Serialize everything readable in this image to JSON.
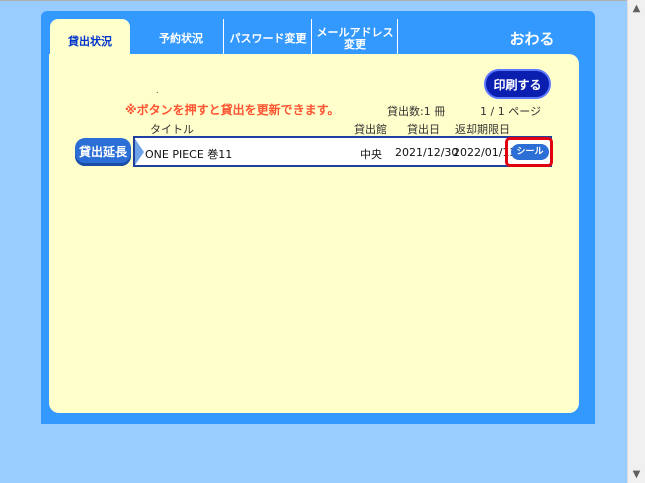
{
  "tabs": [
    {
      "label": "貸出状況"
    },
    {
      "label": "予約状況"
    },
    {
      "label": "パスワード変更"
    },
    {
      "label_line1": "メールアドレス",
      "label_line2": "変更"
    },
    {
      "label": "おわる"
    }
  ],
  "print_label": "印刷する",
  "dot": ".",
  "notice": "※ボタンを押すと貸出を更新できます。",
  "count_text": "貸出数:1 冊",
  "pages_text": "1 / 1 ページ",
  "headers": {
    "title": "タイトル",
    "library": "貸出館",
    "loan_date": "貸出日",
    "due_date": "返却期限日"
  },
  "extend_label": "貸出延長",
  "loan": {
    "title": "ONE PIECE 巻11",
    "library": "中央",
    "loan_date": "2021/12/30",
    "due_date": "2022/01/13",
    "seal_label": "シール"
  },
  "colors": {
    "frame": "#3399ff",
    "content": "#ffffcc",
    "highlight": "#e00010",
    "notice": "#ff5533"
  }
}
